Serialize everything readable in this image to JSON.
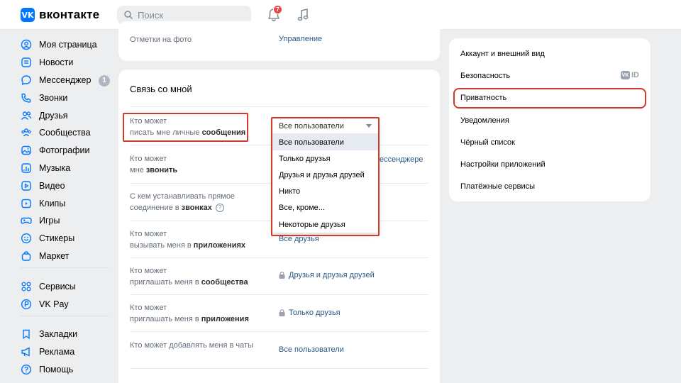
{
  "header": {
    "logo_mark": "VK",
    "logo_text": "вконтакте",
    "search_placeholder": "Поиск",
    "notifications_count": "7"
  },
  "leftnav": {
    "items": [
      {
        "label": "Моя страница",
        "icon": "user-circle-icon"
      },
      {
        "label": "Новости",
        "icon": "news-icon"
      },
      {
        "label": "Мессенджер",
        "icon": "chat-icon",
        "badge": "1"
      },
      {
        "label": "Звонки",
        "icon": "phone-icon"
      },
      {
        "label": "Друзья",
        "icon": "friends-icon"
      },
      {
        "label": "Сообщества",
        "icon": "communities-icon"
      },
      {
        "label": "Фотографии",
        "icon": "photo-icon"
      },
      {
        "label": "Музыка",
        "icon": "music-icon"
      },
      {
        "label": "Видео",
        "icon": "video-icon"
      },
      {
        "label": "Клипы",
        "icon": "clips-icon"
      },
      {
        "label": "Игры",
        "icon": "gamepad-icon"
      },
      {
        "label": "Стикеры",
        "icon": "smile-icon"
      },
      {
        "label": "Маркет",
        "icon": "bag-icon"
      }
    ],
    "items2": [
      {
        "label": "Сервисы",
        "icon": "services-icon"
      },
      {
        "label": "VK Pay",
        "icon": "pay-icon"
      }
    ],
    "items3": [
      {
        "label": "Закладки",
        "icon": "bookmark-icon"
      },
      {
        "label": "Реклама",
        "icon": "megaphone-icon"
      },
      {
        "label": "Помощь",
        "icon": "help-icon"
      }
    ]
  },
  "top_card": {
    "label": "Отметки на фото",
    "value": "Управление"
  },
  "main_card": {
    "title": "Связь со мной",
    "rows": [
      {
        "l1": "Кто может",
        "l2a": "писать мне личные ",
        "l2b": "сообщения",
        "value": "Все пользователи"
      },
      {
        "l1": "Кто может",
        "l2a": "мне ",
        "l2b": "звонить",
        "value_tail": "ессенджере"
      },
      {
        "l1": "С кем устанавливать прямое",
        "l2a": "соединение в ",
        "l2b": "звонках",
        "help": "?"
      },
      {
        "l1": "Кто может",
        "l2a": "вызывать меня в ",
        "l2b": "приложениях",
        "value": "Все друзья"
      },
      {
        "l1": "Кто может",
        "l2a": "приглашать меня в ",
        "l2b": "сообщества",
        "value": "Друзья и друзья друзей"
      },
      {
        "l1": "Кто может",
        "l2a": "приглашать меня в ",
        "l2b": "приложения",
        "value": "Только друзья"
      },
      {
        "l1": "Кто может добавлять меня в чаты",
        "value": "Все пользователи"
      }
    ]
  },
  "dropdown": {
    "current": "Все пользователи",
    "options": [
      "Все пользователи",
      "Только друзья",
      "Друзья и друзья друзей",
      "Никто",
      "Все, кроме...",
      "Некоторые друзья"
    ]
  },
  "rightmenu": {
    "items": [
      "Аккаунт и внешний вид",
      "Безопасность",
      "Приватность",
      "Уведомления",
      "Чёрный список",
      "Настройки приложений",
      "Платёжные сервисы"
    ],
    "vkid_mark": "VK",
    "vkid_text": "ID"
  },
  "colors": {
    "accent": "#0077ff",
    "link": "#2a5885",
    "highlight": "#d13a2a",
    "badge": "#e64646"
  }
}
